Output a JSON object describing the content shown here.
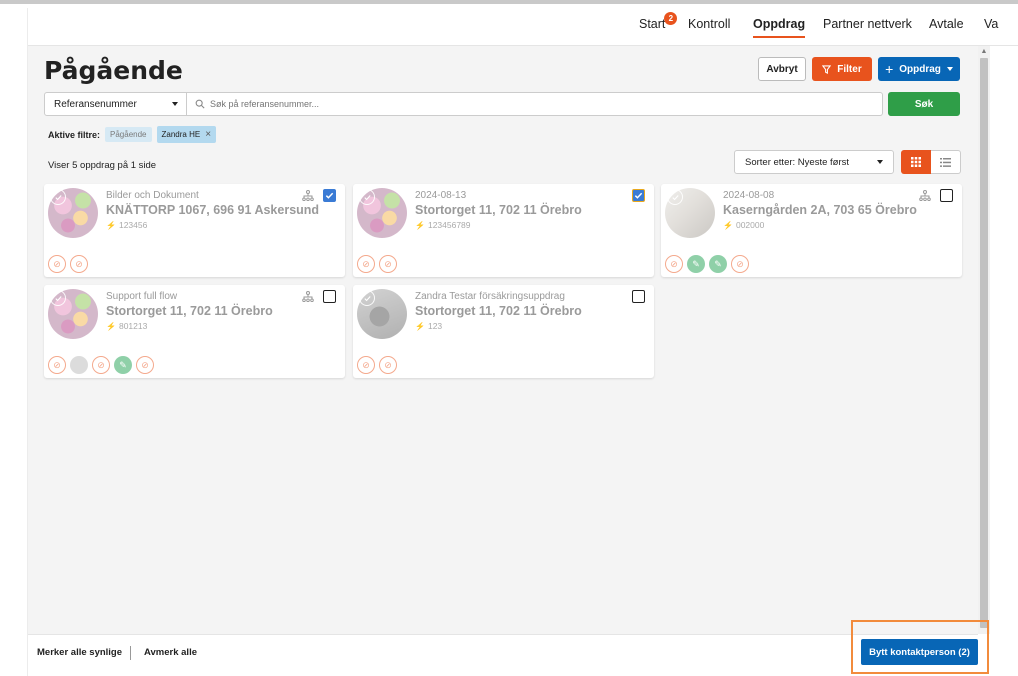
{
  "nav": {
    "items": [
      "Start",
      "Kontroll",
      "Oppdrag",
      "Partner nettverk",
      "Avtale",
      "Va"
    ],
    "start_badge": "2",
    "active": "Oppdrag"
  },
  "page": {
    "title": "Pågående",
    "cancel_label": "Avbryt",
    "filter_label": "Filter",
    "new_label": "Oppdrag"
  },
  "search": {
    "field_select": "Referansenummer",
    "placeholder": "Søk på referansenummer...",
    "value": "",
    "submit_label": "Søk"
  },
  "filters": {
    "label": "Aktive filtre:",
    "chips": [
      "Pågående",
      "Zandra HE"
    ]
  },
  "list": {
    "count_text": "Viser 5 oppdrag på 1 side",
    "sort_label": "Sorter etter: Nyeste først",
    "view_mode": "grid"
  },
  "cards": [
    {
      "subtitle": "Bilder och Dokument",
      "address": "KNÄTTORP 1067, 696 91 Askersund",
      "reference": "123456",
      "checked": true,
      "badges": [
        "o",
        "o"
      ],
      "avatar": "flowers",
      "org_icon": true
    },
    {
      "subtitle": "2024-08-13",
      "address": "Stortorget 11, 702 11 Örebro",
      "reference": "123456789",
      "checked": true,
      "badges": [
        "o",
        "o"
      ],
      "avatar": "flowers",
      "org_icon": false
    },
    {
      "subtitle": "2024-08-08",
      "address": "Kaserngården 2A, 703 65 Örebro",
      "reference": "002000",
      "checked": false,
      "badges": [
        "o",
        "g",
        "g",
        "o"
      ],
      "avatar": "room",
      "org_icon": true
    },
    {
      "subtitle": "Support full flow",
      "address": "Stortorget 11, 702 11 Örebro",
      "reference": "801213",
      "checked": false,
      "badges": [
        "o",
        "l",
        "o",
        "g",
        "o"
      ],
      "avatar": "flowers",
      "org_icon": true
    },
    {
      "subtitle": "Zandra Testar försäkringsuppdrag",
      "address": "Stortorget 11, 702 11 Örebro",
      "reference": "123",
      "checked": false,
      "badges": [
        "o",
        "o"
      ],
      "avatar": "gray",
      "org_icon": false
    }
  ],
  "footer": {
    "select_visible": "Merker alle synlige",
    "deselect_all": "Avmerk alle",
    "change_contact": "Bytt kontaktperson (2)"
  },
  "colors": {
    "accent_orange": "#e8531d",
    "primary_blue": "#0866b6",
    "success_green": "#2f9e48",
    "highlight": "#f28b3c"
  }
}
